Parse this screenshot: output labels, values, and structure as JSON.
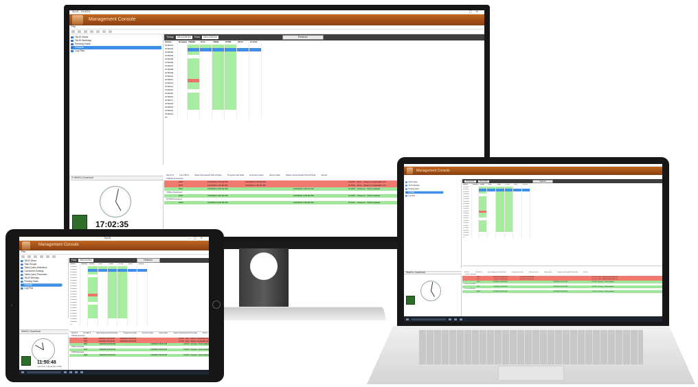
{
  "app": {
    "window_title": "TAUS - GUATA",
    "header_title": "Management Console",
    "menu_file": "File",
    "tree_items": [
      "TAUS Views",
      "TAUS Workday",
      "Pending Tasks",
      "Console",
      "Log Files"
    ],
    "tablet_tree_items": [
      "TAUS Views",
      "Task Groups",
      "Tasks Query Definitions",
      "Connection Settings",
      "Tasks Query Processes",
      "TAUS Workday",
      "Pending Tasks",
      "Console",
      "Log Files"
    ],
    "web_download_label": "WebDL Download"
  },
  "monitor": {
    "date_label": "Today",
    "date_value": "20/12/2016",
    "to_label": "Past",
    "to_value": "20/12/2016",
    "refresh_label": "Refresh",
    "grid_headers": [
      "Station",
      "Readable",
      "TREND",
      "GUA",
      "TMWL",
      "PTPM",
      "PEVC",
      "CLOCK"
    ],
    "stations": [
      "ST00001",
      "ST00002",
      "ST00003",
      "ST00004",
      "ST00005",
      "ST00006",
      "ST00007",
      "ST00008",
      "ST00009",
      "ST00010",
      "ST00011",
      "ST00012",
      "ST00013",
      "ST00014",
      "ST00015",
      "ST00016",
      "ST00017",
      "ST00018",
      "ST00019",
      "ST00020",
      "ST00021",
      "ST"
    ],
    "log_headers": [
      "File ID #",
      "Link DB Id",
      "Tasks Requested Period Date",
      "Programmed Date",
      "Execution Date",
      "Saving Date",
      "Station Downloaded Period Date",
      "Result"
    ],
    "log_groups": [
      "TREND Download",
      "TMWL Download",
      "PTPM Download"
    ],
    "log_lines": [
      {
        "id": "DCP",
        "prog": "12/9/2016 1:00:00 PM",
        "exec": "12/9/2016 1:00:00 PM",
        "save": "",
        "result": "CLOCK - Error - Station unreachable Ctrl.",
        "status": "error"
      },
      {
        "id": "DCP",
        "prog": "12/9/2016 1:00:00 PM",
        "exec": "12/9/2016 1:00:00 PM",
        "save": "",
        "result": "CLOCK - Error - Station unreachable Ctrl.",
        "status": "error"
      },
      {
        "id": "DCP",
        "prog": "12/9/2016 2:00:00 PM",
        "exec": "",
        "save": "12/9/2016 1:59:21 PM",
        "result": "CLOCK - Success - Clock updated",
        "status": "ok"
      },
      {
        "id": "DCP",
        "prog": "12/9/2016 2:00:00 PM",
        "exec": "",
        "save": "12/9/2016 2:00:00 PM",
        "result": "CLOCK - Success - Clock updated",
        "status": "ok"
      },
      {
        "id": "PEM",
        "prog": "12/9/2016 2:00:00 PM",
        "exec": "",
        "save": "12/9/2016 2:00:00 PM",
        "result": "CLOCK - Success - Clock updated",
        "status": "ok"
      }
    ],
    "clock_time": "17:02:35",
    "clock_date": "mercredi 7 décembre 2016"
  },
  "tablet": {
    "window_title": "TAUS",
    "clock_time": "11:50:48",
    "clock_date": "mercredi 7 décembre 2016",
    "date_value": "09/12/2016",
    "refresh_label": "Refresh"
  },
  "laptop": {
    "refresh_label": "Refresh"
  },
  "colors": {
    "header_orange": "#b55a1c",
    "ok_green": "#a8eca0",
    "error_red": "#ef7168",
    "selection_blue": "#3d8ee8"
  }
}
